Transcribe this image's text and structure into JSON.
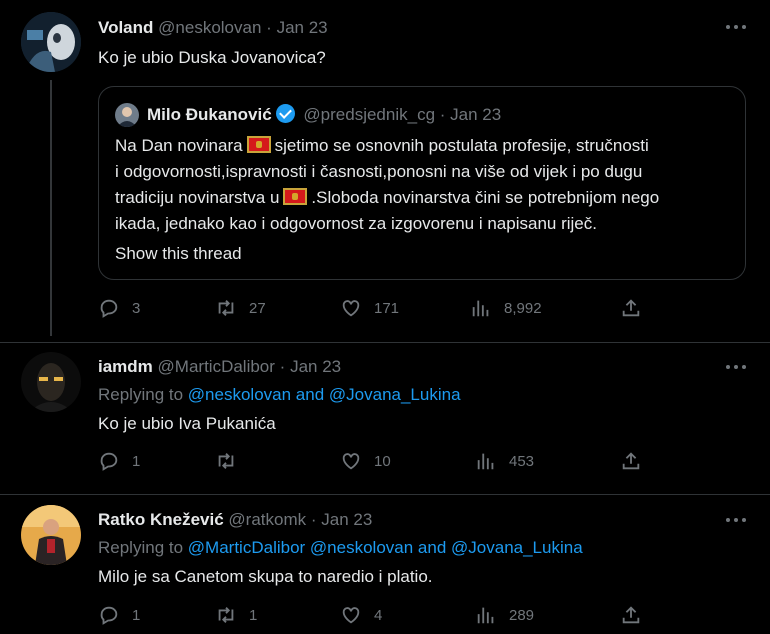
{
  "tweets": [
    {
      "name": "Voland",
      "handle": "@neskolovan",
      "sep": "·",
      "date": "Jan 23",
      "text": "Ko je ubio Duska Jovanovica?",
      "quote": {
        "name": "Milo Đukanović",
        "handle": "@predsjednik_cg",
        "sep": "·",
        "date": "Jan 23",
        "line1a": "Na Dan novinara",
        "line1b": "sjetimo se osnovnih postulata profesije, stručnosti",
        "line2": "i odgovornosti,ispravnosti i časnosti,ponosni na više od vijek i po dugu",
        "line3a": "tradiciju novinarstva u",
        "line3b": ".Sloboda novinarstva čini se potrebnijom nego",
        "line4": "ikada, jednako kao i odgovornost za izgovorenu i napisanu riječ.",
        "show_thread": "Show this thread"
      },
      "replies": "3",
      "retweets": "27",
      "likes": "171",
      "views": "8,992"
    },
    {
      "name": "iamdm",
      "handle": "@MarticDalibor",
      "sep": "·",
      "date": "Jan 23",
      "replying_to": "Replying to",
      "mention1": "@neskolovan",
      "and": "and",
      "mention2": "@Jovana_Lukina",
      "text": "Ko je ubio Iva Pukanića",
      "replies": "1",
      "retweets": "",
      "likes": "10",
      "views": "453"
    },
    {
      "name": "Ratko Knežević",
      "handle": "@ratkomk",
      "sep": "·",
      "date": "Jan 23",
      "replying_to": "Replying to",
      "mention1": "@MarticDalibor",
      "mention2": "@neskolovan",
      "and": "and",
      "mention3": "@Jovana_Lukina",
      "text": "Milo je sa Canetom skupa to naredio i platio.",
      "replies": "1",
      "retweets": "1",
      "likes": "4",
      "views": "289"
    }
  ],
  "icons": [
    "reply-icon",
    "retweet-icon",
    "like-icon",
    "views-icon",
    "share-icon",
    "more-icon",
    "verified-badge-icon",
    "montenegro-flag-icon"
  ],
  "colors": {
    "background": "#000000",
    "text": "#e7e9ea",
    "muted": "#71767b",
    "link": "#1d9bf0",
    "border": "#2f3336"
  }
}
